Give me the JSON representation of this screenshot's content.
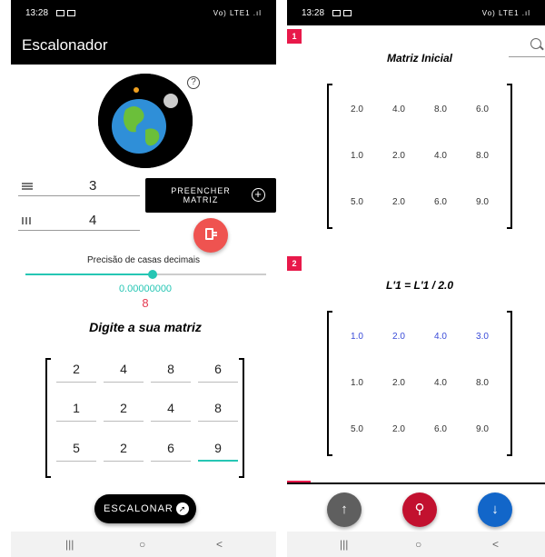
{
  "left_screen": {
    "status": {
      "time": "13:28",
      "indicators": "Vo) LTE1 .ıl"
    },
    "appbar": {
      "title": "Escalonador"
    },
    "rows_field": {
      "value": "3",
      "icon": "rows-icon"
    },
    "cols_field": {
      "value": "4",
      "icon": "columns-icon"
    },
    "fill_button": {
      "label": "PREENCHER MATRIZ",
      "icon": "add-circle-icon"
    },
    "clear_button": {
      "icon": "clear-matrix-icon"
    },
    "help": {
      "icon": "help-icon",
      "glyph": "?"
    },
    "precision": {
      "label": "Precisão de casas decimais",
      "value_text": "0.00000000",
      "digits": "8",
      "slider_fraction": 0.53
    },
    "matrix_heading": "Digite a sua matriz",
    "input_matrix": [
      [
        "2",
        "4",
        "8",
        "6"
      ],
      [
        "1",
        "2",
        "4",
        "8"
      ],
      [
        "5",
        "2",
        "6",
        "9"
      ]
    ],
    "escalonar_button": {
      "label": "ESCALONAR",
      "icon": "escalonar-icon"
    },
    "navbar": {
      "recent": "|||",
      "home": "○",
      "back": "<"
    }
  },
  "right_screen": {
    "status": {
      "time": "13:28",
      "indicators": "Vo) LTE1 .ıl"
    },
    "steps": [
      {
        "number": "1",
        "title": "Matriz Inicial",
        "rows": [
          [
            "2.0",
            "4.0",
            "8.0",
            "6.0"
          ],
          [
            "1.0",
            "2.0",
            "4.0",
            "8.0"
          ],
          [
            "5.0",
            "2.0",
            "6.0",
            "9.0"
          ]
        ],
        "highlight_row": -1
      },
      {
        "number": "2",
        "title": "L'1 = L'1 / 2.0",
        "rows": [
          [
            "1.0",
            "2.0",
            "4.0",
            "3.0"
          ],
          [
            "1.0",
            "2.0",
            "4.0",
            "8.0"
          ],
          [
            "5.0",
            "2.0",
            "6.0",
            "9.0"
          ]
        ],
        "highlight_row": 0
      }
    ],
    "fabs": [
      {
        "name": "scroll-up-button",
        "glyph": "↑",
        "color": "#5f5f5f"
      },
      {
        "name": "search-button",
        "glyph": "⚲",
        "color": "#c2112f"
      },
      {
        "name": "scroll-down-button",
        "glyph": "↓",
        "color": "#1266c9"
      }
    ],
    "navbar": {
      "recent": "|||",
      "home": "○",
      "back": "<"
    }
  },
  "colors": {
    "accent": "#26c6b4",
    "danger": "#e8194a",
    "highlight_text": "#3a4bd8",
    "appbar": "#000000"
  }
}
